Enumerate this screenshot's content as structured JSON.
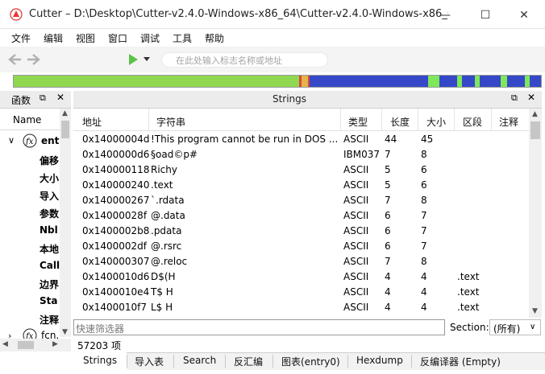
{
  "window": {
    "title": "Cutter – D:\\Desktop\\Cutter-v2.4.0-Windows-x86_64\\Cutter-v2.4.0-Windows-x86_64\\c...",
    "minimize": "—",
    "maximize": "☐",
    "close": "✕"
  },
  "menu": [
    "文件",
    "编辑",
    "视图",
    "窗口",
    "调试",
    "工具",
    "帮助"
  ],
  "toolbar": {
    "back_icon": "back-arrow",
    "forward_icon": "forward-arrow",
    "play_icon": "play",
    "search_placeholder": "在此处输入标志名称或地址"
  },
  "overview_colors": {
    "green": "#8fd84f",
    "red": "#d9483a",
    "orange": "#e6b34a",
    "blue": "#3548c8",
    "light_green": "#7ee85a"
  },
  "left_panel": {
    "title": "函数",
    "column": "Name",
    "root_label": "ent",
    "items": [
      "偏移",
      "大小",
      "导入",
      "参数",
      "Nbl",
      "本地",
      "Call",
      "边界",
      "Sta",
      "注释"
    ],
    "bottom_label": "fcn."
  },
  "strings_panel": {
    "title": "Strings",
    "columns": [
      "地址",
      "字符串",
      "类型",
      "长度",
      "大小",
      "区段",
      "注释"
    ],
    "rows": [
      [
        "0x14000004d",
        "!This program cannot be run in DOS ...",
        "ASCII",
        "44",
        "45",
        ""
      ],
      [
        "0x1400000d6",
        "§oad©p#",
        "IBM037",
        "7",
        "8",
        ""
      ],
      [
        "0x140000118",
        "Richy",
        "ASCII",
        "5",
        "6",
        ""
      ],
      [
        "0x140000240",
        ".text",
        "ASCII",
        "5",
        "6",
        ""
      ],
      [
        "0x140000267",
        "`.rdata",
        "ASCII",
        "7",
        "8",
        ""
      ],
      [
        "0x14000028f",
        "@.data",
        "ASCII",
        "6",
        "7",
        ""
      ],
      [
        "0x1400002b8",
        ".pdata",
        "ASCII",
        "6",
        "7",
        ""
      ],
      [
        "0x1400002df",
        "@.rsrc",
        "ASCII",
        "6",
        "7",
        ""
      ],
      [
        "0x140000307",
        "@.reloc",
        "ASCII",
        "7",
        "8",
        ""
      ],
      [
        "0x1400010d6",
        "D$(H",
        "ASCII",
        "4",
        "4",
        ".text"
      ],
      [
        "0x1400010e4",
        "T$ H",
        "ASCII",
        "4",
        "4",
        ".text"
      ],
      [
        "0x1400010f7",
        "L$ H",
        "ASCII",
        "4",
        "4",
        ".text"
      ]
    ],
    "filter_placeholder": "快速筛选器",
    "section_label": "Section:",
    "section_value": "(所有)",
    "count": "57203 项"
  },
  "bottom_tabs": [
    "Strings",
    "导入表",
    "Search",
    "反汇编",
    "图表(entry0)",
    "Hexdump",
    "反编译器 (Empty)"
  ]
}
